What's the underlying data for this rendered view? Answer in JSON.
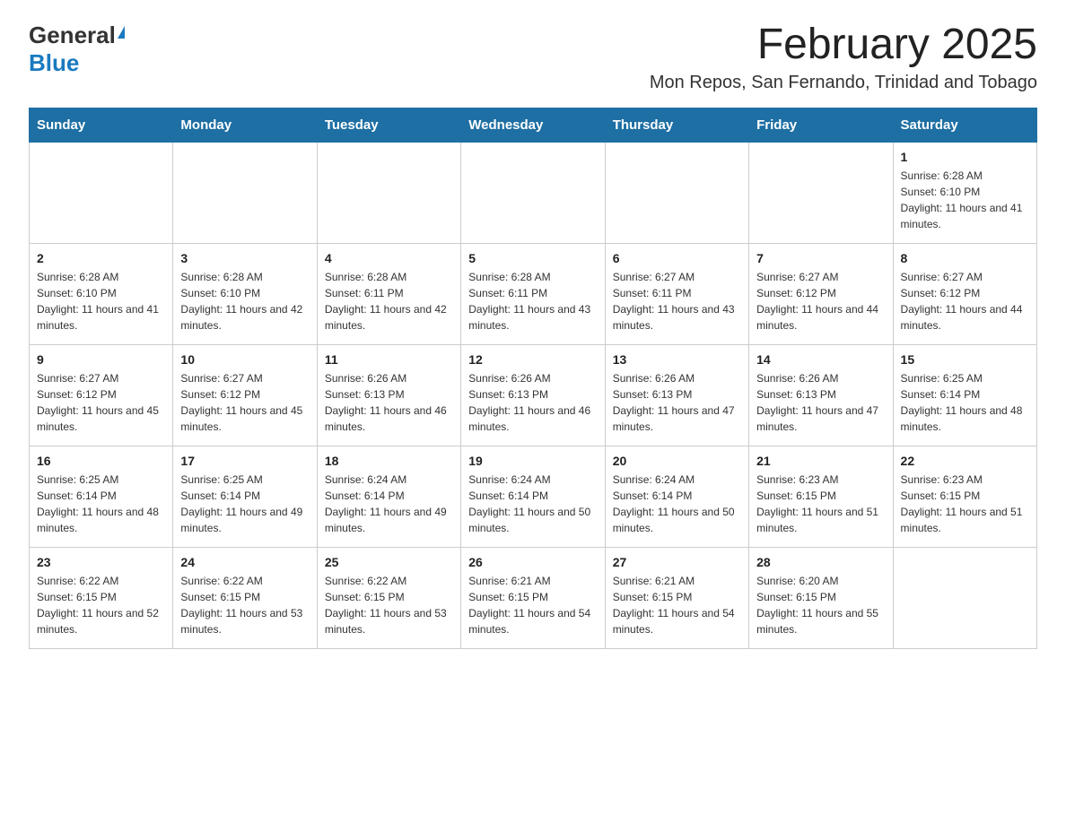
{
  "header": {
    "logo_general": "General",
    "logo_blue": "Blue",
    "main_title": "February 2025",
    "subtitle": "Mon Repos, San Fernando, Trinidad and Tobago"
  },
  "calendar": {
    "days_of_week": [
      "Sunday",
      "Monday",
      "Tuesday",
      "Wednesday",
      "Thursday",
      "Friday",
      "Saturday"
    ],
    "weeks": [
      {
        "days": [
          {
            "number": "",
            "info": ""
          },
          {
            "number": "",
            "info": ""
          },
          {
            "number": "",
            "info": ""
          },
          {
            "number": "",
            "info": ""
          },
          {
            "number": "",
            "info": ""
          },
          {
            "number": "",
            "info": ""
          },
          {
            "number": "1",
            "info": "Sunrise: 6:28 AM\nSunset: 6:10 PM\nDaylight: 11 hours and 41 minutes."
          }
        ]
      },
      {
        "days": [
          {
            "number": "2",
            "info": "Sunrise: 6:28 AM\nSunset: 6:10 PM\nDaylight: 11 hours and 41 minutes."
          },
          {
            "number": "3",
            "info": "Sunrise: 6:28 AM\nSunset: 6:10 PM\nDaylight: 11 hours and 42 minutes."
          },
          {
            "number": "4",
            "info": "Sunrise: 6:28 AM\nSunset: 6:11 PM\nDaylight: 11 hours and 42 minutes."
          },
          {
            "number": "5",
            "info": "Sunrise: 6:28 AM\nSunset: 6:11 PM\nDaylight: 11 hours and 43 minutes."
          },
          {
            "number": "6",
            "info": "Sunrise: 6:27 AM\nSunset: 6:11 PM\nDaylight: 11 hours and 43 minutes."
          },
          {
            "number": "7",
            "info": "Sunrise: 6:27 AM\nSunset: 6:12 PM\nDaylight: 11 hours and 44 minutes."
          },
          {
            "number": "8",
            "info": "Sunrise: 6:27 AM\nSunset: 6:12 PM\nDaylight: 11 hours and 44 minutes."
          }
        ]
      },
      {
        "days": [
          {
            "number": "9",
            "info": "Sunrise: 6:27 AM\nSunset: 6:12 PM\nDaylight: 11 hours and 45 minutes."
          },
          {
            "number": "10",
            "info": "Sunrise: 6:27 AM\nSunset: 6:12 PM\nDaylight: 11 hours and 45 minutes."
          },
          {
            "number": "11",
            "info": "Sunrise: 6:26 AM\nSunset: 6:13 PM\nDaylight: 11 hours and 46 minutes."
          },
          {
            "number": "12",
            "info": "Sunrise: 6:26 AM\nSunset: 6:13 PM\nDaylight: 11 hours and 46 minutes."
          },
          {
            "number": "13",
            "info": "Sunrise: 6:26 AM\nSunset: 6:13 PM\nDaylight: 11 hours and 47 minutes."
          },
          {
            "number": "14",
            "info": "Sunrise: 6:26 AM\nSunset: 6:13 PM\nDaylight: 11 hours and 47 minutes."
          },
          {
            "number": "15",
            "info": "Sunrise: 6:25 AM\nSunset: 6:14 PM\nDaylight: 11 hours and 48 minutes."
          }
        ]
      },
      {
        "days": [
          {
            "number": "16",
            "info": "Sunrise: 6:25 AM\nSunset: 6:14 PM\nDaylight: 11 hours and 48 minutes."
          },
          {
            "number": "17",
            "info": "Sunrise: 6:25 AM\nSunset: 6:14 PM\nDaylight: 11 hours and 49 minutes."
          },
          {
            "number": "18",
            "info": "Sunrise: 6:24 AM\nSunset: 6:14 PM\nDaylight: 11 hours and 49 minutes."
          },
          {
            "number": "19",
            "info": "Sunrise: 6:24 AM\nSunset: 6:14 PM\nDaylight: 11 hours and 50 minutes."
          },
          {
            "number": "20",
            "info": "Sunrise: 6:24 AM\nSunset: 6:14 PM\nDaylight: 11 hours and 50 minutes."
          },
          {
            "number": "21",
            "info": "Sunrise: 6:23 AM\nSunset: 6:15 PM\nDaylight: 11 hours and 51 minutes."
          },
          {
            "number": "22",
            "info": "Sunrise: 6:23 AM\nSunset: 6:15 PM\nDaylight: 11 hours and 51 minutes."
          }
        ]
      },
      {
        "days": [
          {
            "number": "23",
            "info": "Sunrise: 6:22 AM\nSunset: 6:15 PM\nDaylight: 11 hours and 52 minutes."
          },
          {
            "number": "24",
            "info": "Sunrise: 6:22 AM\nSunset: 6:15 PM\nDaylight: 11 hours and 53 minutes."
          },
          {
            "number": "25",
            "info": "Sunrise: 6:22 AM\nSunset: 6:15 PM\nDaylight: 11 hours and 53 minutes."
          },
          {
            "number": "26",
            "info": "Sunrise: 6:21 AM\nSunset: 6:15 PM\nDaylight: 11 hours and 54 minutes."
          },
          {
            "number": "27",
            "info": "Sunrise: 6:21 AM\nSunset: 6:15 PM\nDaylight: 11 hours and 54 minutes."
          },
          {
            "number": "28",
            "info": "Sunrise: 6:20 AM\nSunset: 6:15 PM\nDaylight: 11 hours and 55 minutes."
          },
          {
            "number": "",
            "info": ""
          }
        ]
      }
    ]
  }
}
